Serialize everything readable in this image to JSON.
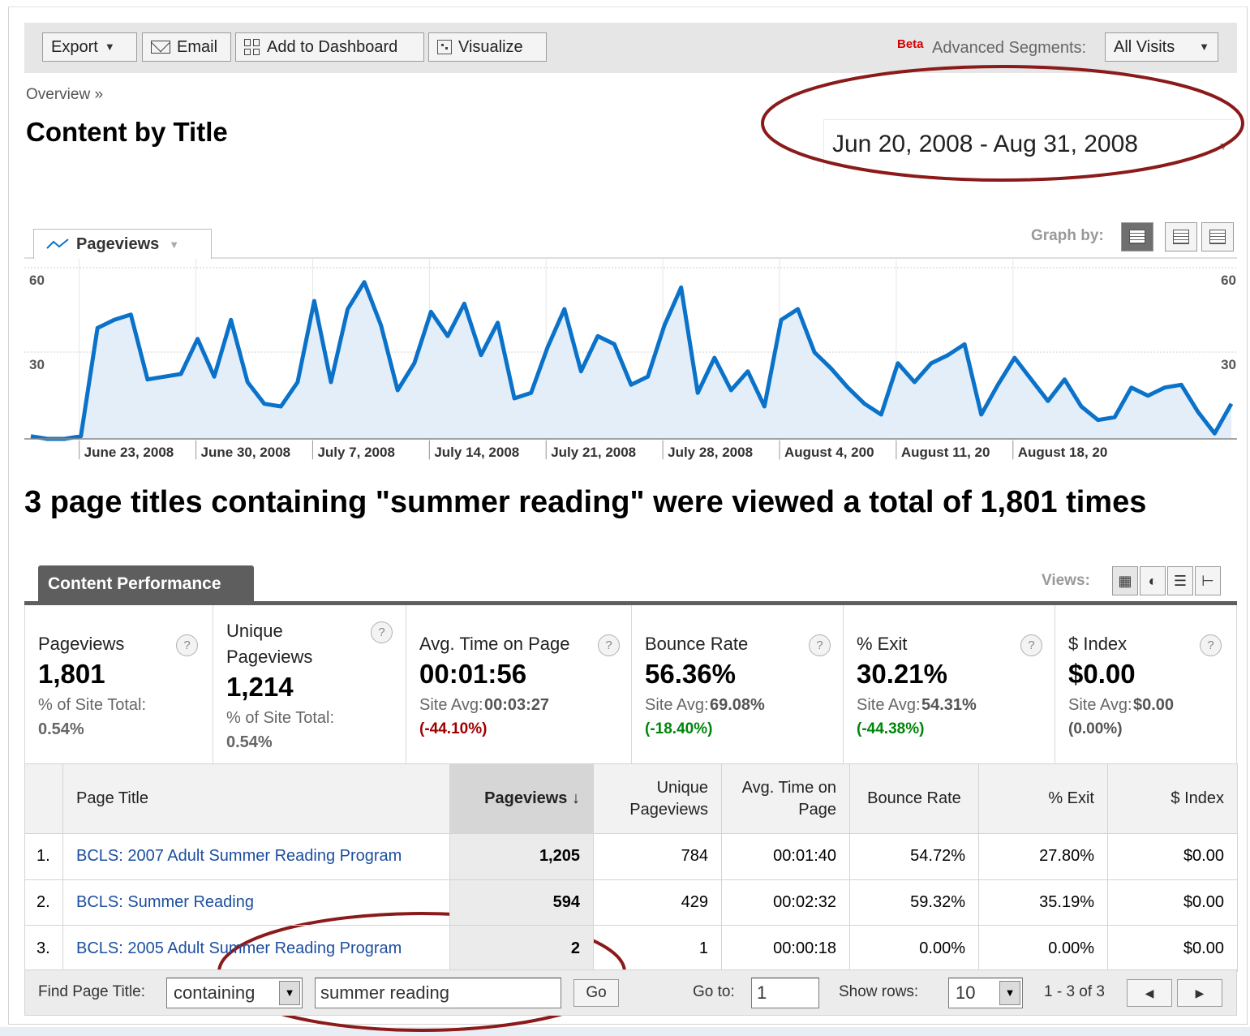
{
  "toolbar": {
    "export_label": "Export",
    "email_label": "Email",
    "dashboard_label": "Add to Dashboard",
    "visualize_label": "Visualize",
    "beta_label": "Beta",
    "segments_label": "Advanced Segments:",
    "segment_value": "All Visits"
  },
  "breadcrumb": "Overview »",
  "page_title": "Content by Title",
  "date_range": "Jun 20, 2008 - Aug 31, 2008",
  "graph": {
    "metric_label": "Pageviews",
    "graph_by_label": "Graph by:",
    "accent_color": "#0b72c9",
    "fill_color": "#e3eef9"
  },
  "chart_data": {
    "type": "area",
    "series": [
      {
        "name": "Pageviews",
        "values": [
          1,
          0,
          0,
          1,
          41,
          44,
          46,
          22,
          23,
          24,
          37,
          23,
          44,
          21,
          13,
          12,
          21,
          51,
          21,
          48,
          58,
          42,
          18,
          28,
          47,
          38,
          50,
          31,
          43,
          15,
          17,
          34,
          48,
          25,
          38,
          35,
          20,
          23,
          42,
          56,
          17,
          30,
          18,
          25,
          12,
          44,
          48,
          32,
          26,
          19,
          13,
          9,
          28,
          21,
          28,
          31,
          35,
          9,
          20,
          30,
          22,
          14,
          22,
          12,
          7,
          8,
          19,
          16,
          19,
          20,
          10,
          2,
          13
        ]
      }
    ],
    "x_tick_labels": [
      "June 23, 2008",
      "June 30, 2008",
      "July 7, 2008",
      "July 14, 2008",
      "July 21, 2008",
      "July 28, 2008",
      "August 4, 200",
      "August 11, 20",
      "August 18, 20"
    ],
    "y_ticks": [
      30,
      60
    ],
    "ylim": [
      0,
      60
    ],
    "grid": true
  },
  "summary": "3 page titles containing \"summer reading\" were viewed a total of 1,801 times",
  "content_performance": {
    "tab_label": "Content Performance",
    "views_label": "Views:"
  },
  "scorecard": [
    {
      "label": "Pageviews",
      "value": "1,801",
      "sub_label": "% of Site Total:",
      "sub_value": "0.54%",
      "delta": ""
    },
    {
      "label": "Unique Pageviews",
      "value": "1,214",
      "sub_label": "% of Site Total:",
      "sub_value": "0.54%",
      "delta": ""
    },
    {
      "label": "Avg. Time on Page",
      "value": "00:01:56",
      "sub_label": "Site Avg:",
      "sub_value": "00:03:27",
      "delta": "(-44.10%)"
    },
    {
      "label": "Bounce Rate",
      "value": "56.36%",
      "sub_label": "Site Avg:",
      "sub_value": "69.08%",
      "delta": "(-18.40%)"
    },
    {
      "label": "% Exit",
      "value": "30.21%",
      "sub_label": "Site Avg:",
      "sub_value": "54.31%",
      "delta": "(-44.38%)"
    },
    {
      "label": "$ Index",
      "value": "$0.00",
      "sub_label": "Site Avg:",
      "sub_value": "$0.00",
      "delta": "(0.00%)"
    }
  ],
  "table": {
    "columns": [
      "Page Title",
      "Pageviews",
      "Unique Pageviews",
      "Avg. Time on Page",
      "Bounce Rate",
      "% Exit",
      "$ Index"
    ],
    "rows": [
      {
        "rank": "1.",
        "title": "BCLS: 2007 Adult Summer Reading Program",
        "pageviews": "1,205",
        "unique": "784",
        "avg_time": "00:01:40",
        "bounce": "54.72%",
        "exit": "27.80%",
        "index": "$0.00"
      },
      {
        "rank": "2.",
        "title": "BCLS: Summer Reading",
        "pageviews": "594",
        "unique": "429",
        "avg_time": "00:02:32",
        "bounce": "59.32%",
        "exit": "35.19%",
        "index": "$0.00"
      },
      {
        "rank": "3.",
        "title": "BCLS: 2005 Adult Summer Reading Program",
        "pageviews": "2",
        "unique": "1",
        "avg_time": "00:00:18",
        "bounce": "0.00%",
        "exit": "0.00%",
        "index": "$0.00"
      }
    ]
  },
  "footer": {
    "find_label": "Find Page Title:",
    "filter_mode": "containing",
    "filter_value": "summer reading",
    "go_label": "Go",
    "goto_label": "Go to:",
    "goto_value": "1",
    "show_rows_label": "Show rows:",
    "show_rows_value": "10",
    "range_text": "1 - 3 of 3"
  },
  "annotation_color": "#8b1a1a"
}
